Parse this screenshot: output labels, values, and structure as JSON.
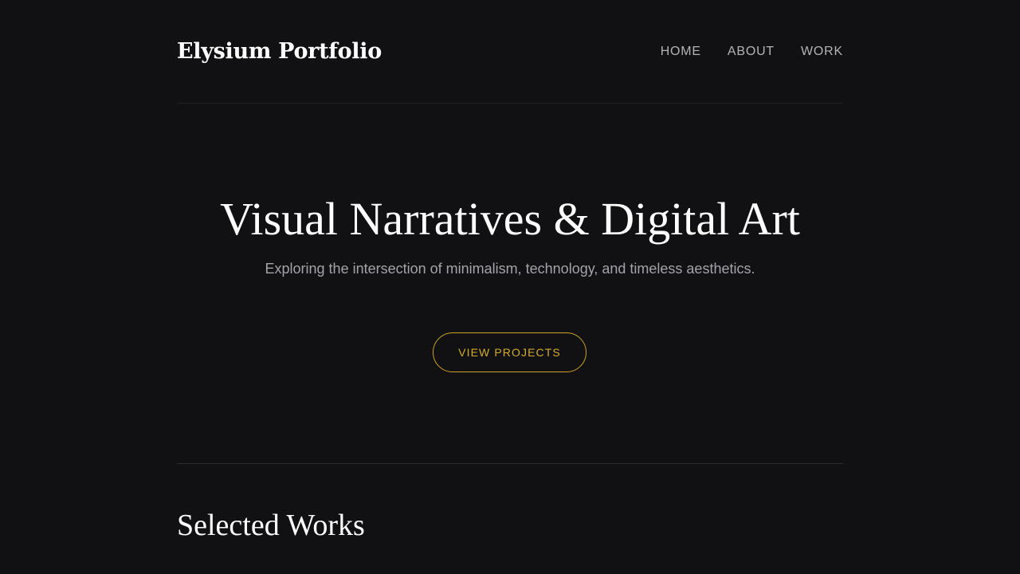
{
  "header": {
    "brand": "Elysium Portfolio",
    "nav": [
      {
        "label": "HOME"
      },
      {
        "label": "ABOUT"
      },
      {
        "label": "WORK"
      }
    ]
  },
  "hero": {
    "title": "Visual Narratives & Digital Art",
    "subtitle": "Exploring the intersection of minimalism, technology, and timeless aesthetics.",
    "cta_label": "VIEW PROJECTS"
  },
  "works": {
    "title": "Selected Works"
  },
  "colors": {
    "background": "#111113",
    "accent": "#d4ac2b",
    "text_primary": "#ffffff",
    "text_secondary": "#a3a3aa"
  }
}
